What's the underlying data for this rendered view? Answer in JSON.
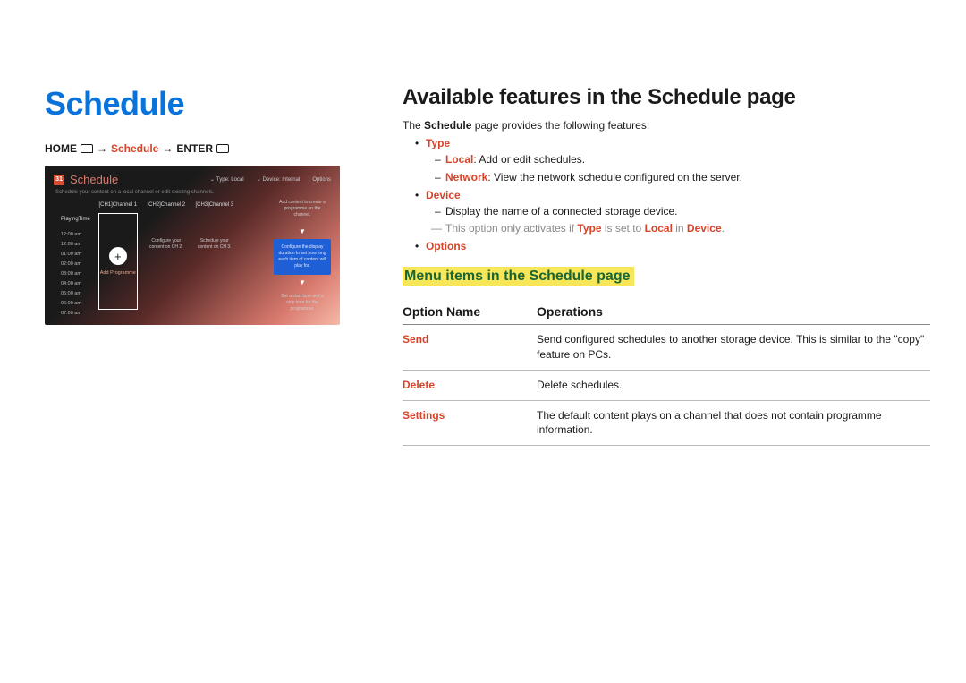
{
  "left": {
    "title": "Schedule",
    "breadcrumb": {
      "home": "HOME",
      "arrow1": "→",
      "schedule": "Schedule",
      "arrow2": "→",
      "enter": "ENTER"
    },
    "screenshot": {
      "cal_number": "31",
      "title": "Schedule",
      "tabs": {
        "type": "Type: Local",
        "device": "Device: Internal",
        "options": "Options"
      },
      "subtitle": "Schedule your content on a local channel or edit existing channels.",
      "times_head": "PlayingTime",
      "times": [
        "12:00 am",
        "12:00 am",
        "01:00 am",
        "02:00 am",
        "03:00 am",
        "04:00 am",
        "05:00 am",
        "06:00 am",
        "07:00 am"
      ],
      "ch1": "[CH1]Channel 1",
      "ch2": "[CH2]Channel 2",
      "ch3": "[CH3]Channel 3",
      "add_programme": "Add Programme",
      "ch2_text": "Configure your content on CH 2.",
      "ch3_text": "Schedule your content on CH 3.",
      "side_top": "Add content to create a programme on the channel.",
      "side_blue": "Configure the display duration to set how long each item of content will play for.",
      "side_bot": "Set a start time and a stop time for the programme."
    }
  },
  "right": {
    "heading": "Available features in the Schedule page",
    "intro_pre": "The ",
    "intro_bold": "Schedule",
    "intro_post": " page provides the following features.",
    "features": {
      "type": {
        "label": "Type",
        "local_label": "Local",
        "local_text": ": Add or edit schedules.",
        "network_label": "Network",
        "network_text": ": View the network schedule configured on the server."
      },
      "device": {
        "label": "Device",
        "line1": "Display the name of a connected storage device.",
        "gray_pre": "This option only activates if ",
        "gray_type": "Type",
        "gray_mid": " is set to ",
        "gray_local": "Local",
        "gray_in": " in ",
        "gray_device": "Device",
        "gray_dot": "."
      },
      "options": {
        "label": "Options"
      }
    },
    "subheading": "Menu items in the Schedule page",
    "table": {
      "col1": "Option Name",
      "col2": "Operations",
      "rows": [
        {
          "name": "Send",
          "ops": "Send configured schedules to another storage device. This is similar to the \"copy\" feature on PCs."
        },
        {
          "name": "Delete",
          "ops": "Delete schedules."
        },
        {
          "name": "Settings",
          "ops": "The default content plays on a channel that does not contain programme information."
        }
      ]
    }
  }
}
